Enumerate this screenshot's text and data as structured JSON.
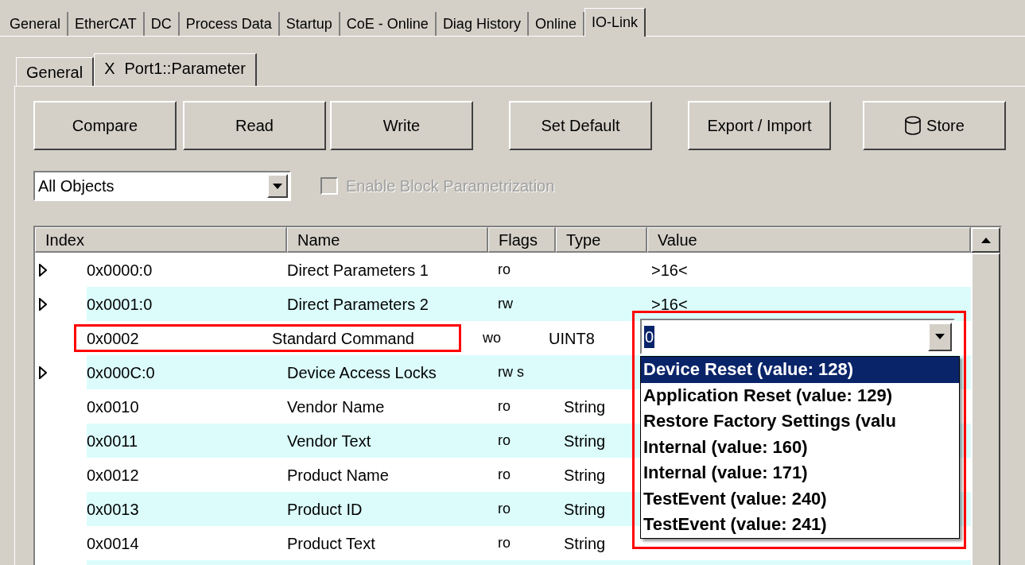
{
  "main_tabs": [
    {
      "label": "General",
      "selected": false
    },
    {
      "label": "EtherCAT",
      "selected": false
    },
    {
      "label": "DC",
      "selected": false
    },
    {
      "label": "Process Data",
      "selected": false
    },
    {
      "label": "Startup",
      "selected": false
    },
    {
      "label": "CoE - Online",
      "selected": false
    },
    {
      "label": "Diag History",
      "selected": false
    },
    {
      "label": "Online",
      "selected": false
    },
    {
      "label": "IO-Link",
      "selected": true
    }
  ],
  "sub_tabs": [
    {
      "label": "General",
      "selected": false
    },
    {
      "label": "Port1::Parameter",
      "close": "X",
      "selected": true
    }
  ],
  "buttons": [
    {
      "label": "Compare",
      "kind": "plain"
    },
    {
      "label": "Read",
      "kind": "plain"
    },
    {
      "label": "Write",
      "kind": "plain"
    },
    {
      "label": "Set Default",
      "kind": "plain"
    },
    {
      "label": "Export / Import",
      "kind": "plain"
    },
    {
      "label": "Store",
      "kind": "store"
    }
  ],
  "filter": {
    "value": "All Objects"
  },
  "block_param": {
    "label": "Enable Block Parametrization",
    "checked": false,
    "disabled": true
  },
  "table": {
    "columns": [
      "Index",
      "Name",
      "Flags",
      "Type",
      "Value"
    ],
    "rows": [
      {
        "expandable": true,
        "highlighted": false,
        "index": "0x0000:0",
        "name": "Direct Parameters 1",
        "flags": "ro",
        "value": ">16<"
      },
      {
        "expandable": true,
        "highlighted": false,
        "index": "0x0001:0",
        "name": "Direct Parameters 2",
        "flags": "rw",
        "value": ">16<"
      },
      {
        "expandable": false,
        "highlighted": true,
        "index": "0x0002",
        "name": "Standard Command",
        "flags": "wo",
        "type": "UINT8",
        "editor": {
          "value": "0",
          "highlighted": true,
          "options": [
            {
              "label": "Device Reset (value: 128)",
              "selected": true
            },
            {
              "label": "Application Reset (value: 129)",
              "selected": false
            },
            {
              "label": "Restore Factory Settings (valu",
              "selected": false
            },
            {
              "label": "Internal (value: 160)",
              "selected": false
            },
            {
              "label": "Internal (value: 171)",
              "selected": false
            },
            {
              "label": "TestEvent (value: 240)",
              "selected": false
            },
            {
              "label": "TestEvent (value: 241)",
              "selected": false
            }
          ]
        }
      },
      {
        "expandable": true,
        "highlighted": false,
        "index": "0x000C:0",
        "name": "Device Access Locks",
        "flags": "rw s"
      },
      {
        "expandable": false,
        "highlighted": false,
        "index": "0x0010",
        "name": "Vendor Name",
        "flags": "ro",
        "type": "String"
      },
      {
        "expandable": false,
        "highlighted": false,
        "index": "0x0011",
        "name": "Vendor Text",
        "flags": "ro",
        "type": "String"
      },
      {
        "expandable": false,
        "highlighted": false,
        "index": "0x0012",
        "name": "Product Name",
        "flags": "ro",
        "type": "String"
      },
      {
        "expandable": false,
        "highlighted": false,
        "index": "0x0013",
        "name": "Product ID",
        "flags": "ro",
        "type": "String"
      },
      {
        "expandable": false,
        "highlighted": false,
        "index": "0x0014",
        "name": "Product Text",
        "flags": "ro",
        "type": "String"
      }
    ]
  }
}
